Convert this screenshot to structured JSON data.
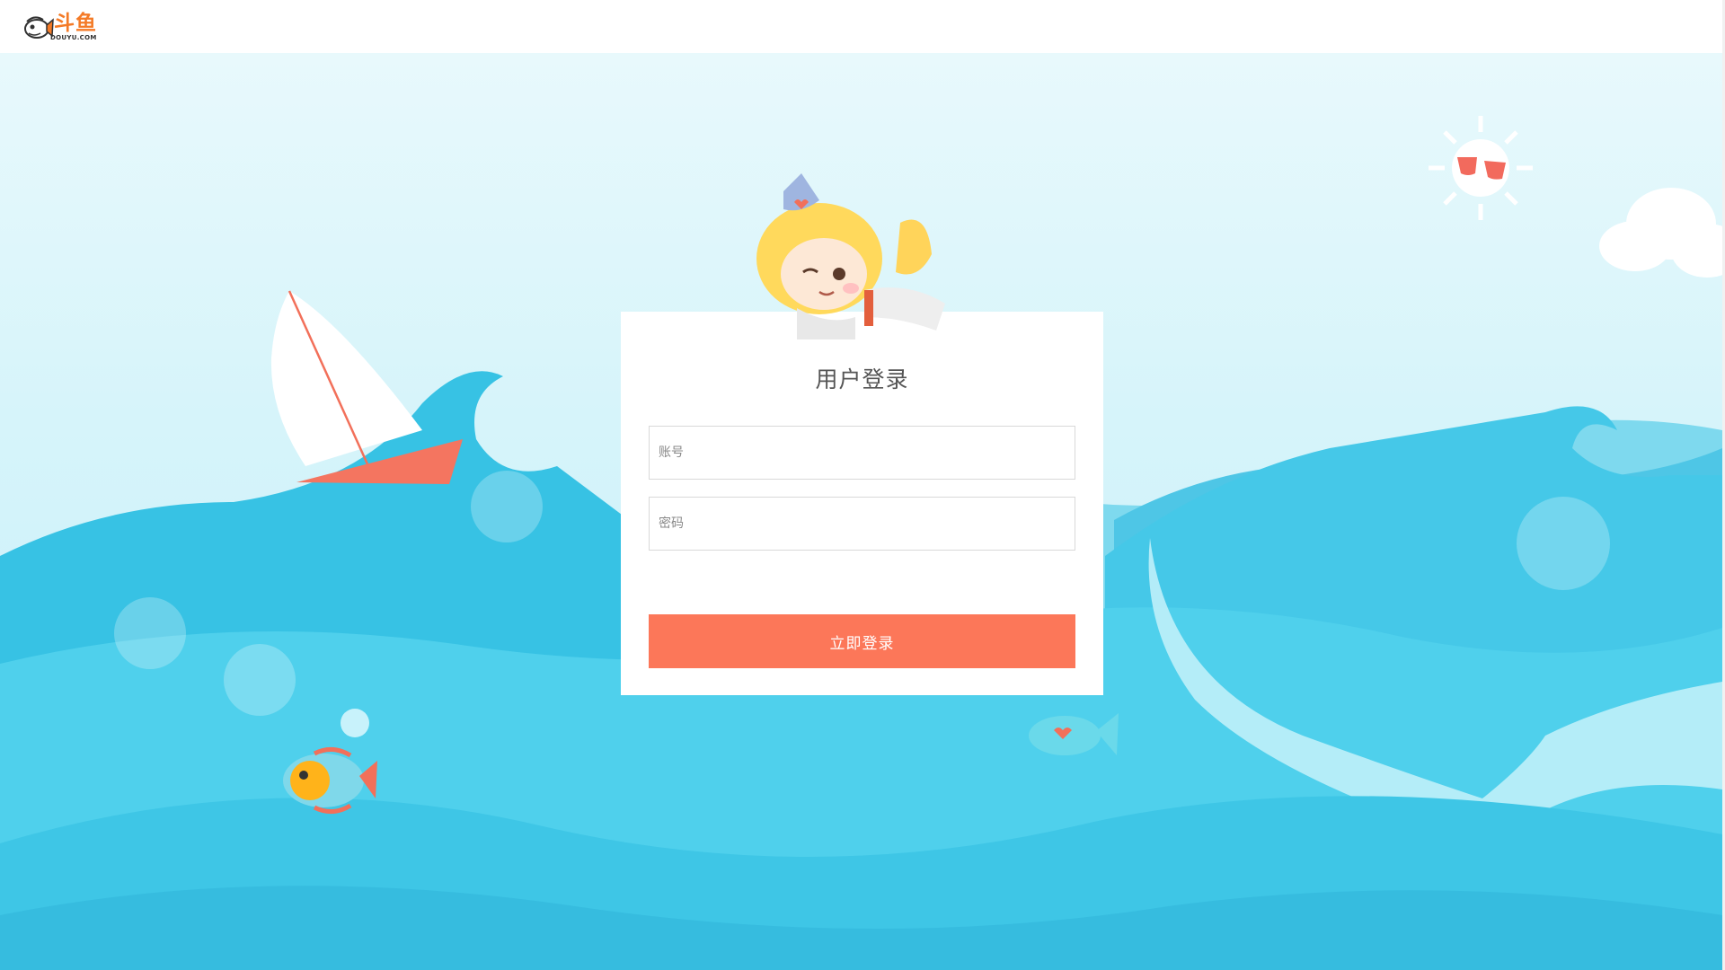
{
  "header": {
    "logo_cn": "斗鱼",
    "logo_en": "DOUYU.COM"
  },
  "login": {
    "title": "用户登录",
    "account_placeholder": "账号",
    "password_placeholder": "密码",
    "submit_label": "立即登录"
  },
  "colors": {
    "brand": "#f47a26",
    "button": "#fc7759",
    "sea": "#4bcde9",
    "sky": "#dff6fb"
  },
  "icons": {
    "logo": "fish-mascot-icon",
    "sun": "sun-with-sunglasses-icon"
  }
}
